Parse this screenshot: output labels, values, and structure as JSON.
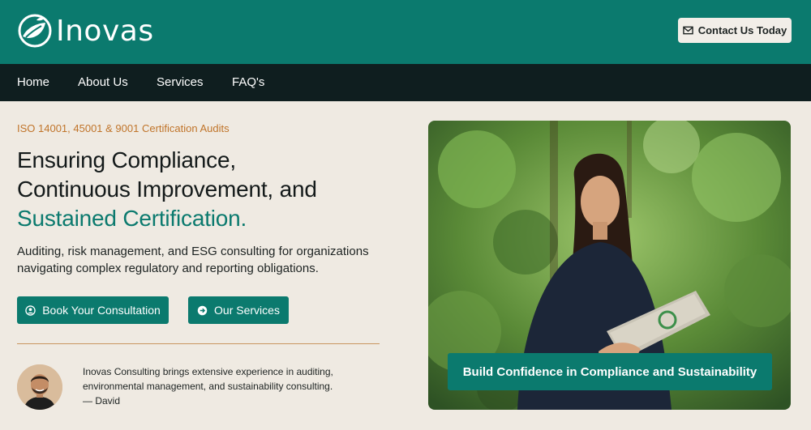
{
  "brand": {
    "name": "Inovas"
  },
  "header": {
    "contact_label": "Contact Us Today"
  },
  "nav": {
    "items": [
      {
        "label": "Home"
      },
      {
        "label": "About Us"
      },
      {
        "label": "Services"
      },
      {
        "label": "FAQ's"
      }
    ]
  },
  "hero": {
    "eyebrow": "ISO 14001, 45001 & 9001 Certification Audits",
    "headline_line1": "Ensuring Compliance,",
    "headline_line2": "Continuous Improvement, and",
    "headline_accent": "Sustained Certification.",
    "subtext": "Auditing, risk management, and ESG consulting for organizations navigating complex regulatory and reporting obligations.",
    "primary_button": "Book Your Consultation",
    "secondary_button": "Our Services",
    "image_banner": "Build Confidence in Compliance and Sustainability"
  },
  "testimonial": {
    "text": "Inovas Consulting brings extensive experience in auditing, environmental management, and sustainability consulting.",
    "author": "— David"
  },
  "colors": {
    "brand_teal": "#0b7a6e",
    "nav_dark": "#0f1e1f",
    "page_bg": "#efeae2",
    "eyebrow_orange": "#c0742a"
  }
}
